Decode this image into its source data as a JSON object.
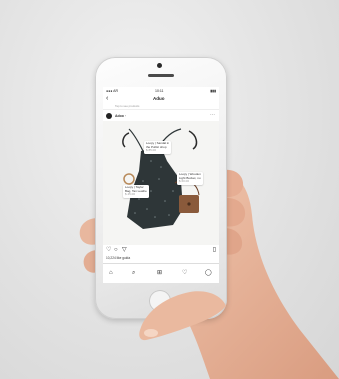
{
  "status_bar": {
    "carrier": "●●● AR",
    "time": "10:11",
    "battery": "▮▮▮"
  },
  "nav": {
    "back_glyph": "‹",
    "title": "Aduo"
  },
  "sub_caption": "Tap to see products",
  "post": {
    "username": "Adoo ·",
    "more_glyph": "⋯",
    "tags": [
      {
        "name": "Loopy | Sandal in",
        "detail": "the Public shop",
        "price": "$ 85.00"
      },
      {
        "name": "Loopy | Wooden",
        "detail": "Light Bucket, nu",
        "price": "$ 60.00"
      },
      {
        "name": "Loopy | Taylor",
        "detail": "Bag, Tan Leathe",
        "price": "$ 45.00"
      }
    ]
  },
  "actions": {
    "like_glyph": "♡",
    "comment_glyph": "○",
    "share_glyph": "▽",
    "save_glyph": "▯"
  },
  "likes_text": "10,224 like guida",
  "tabs": {
    "home": "⌂",
    "search": "⌕",
    "add": "⊞",
    "heart": "♡",
    "profile": "◯"
  },
  "colors": {
    "background": "#e2e2e2",
    "skin": "#e8b79e",
    "phone_body": "#ececec",
    "dress": "#2e3638",
    "bag": "#8a5a3b"
  }
}
